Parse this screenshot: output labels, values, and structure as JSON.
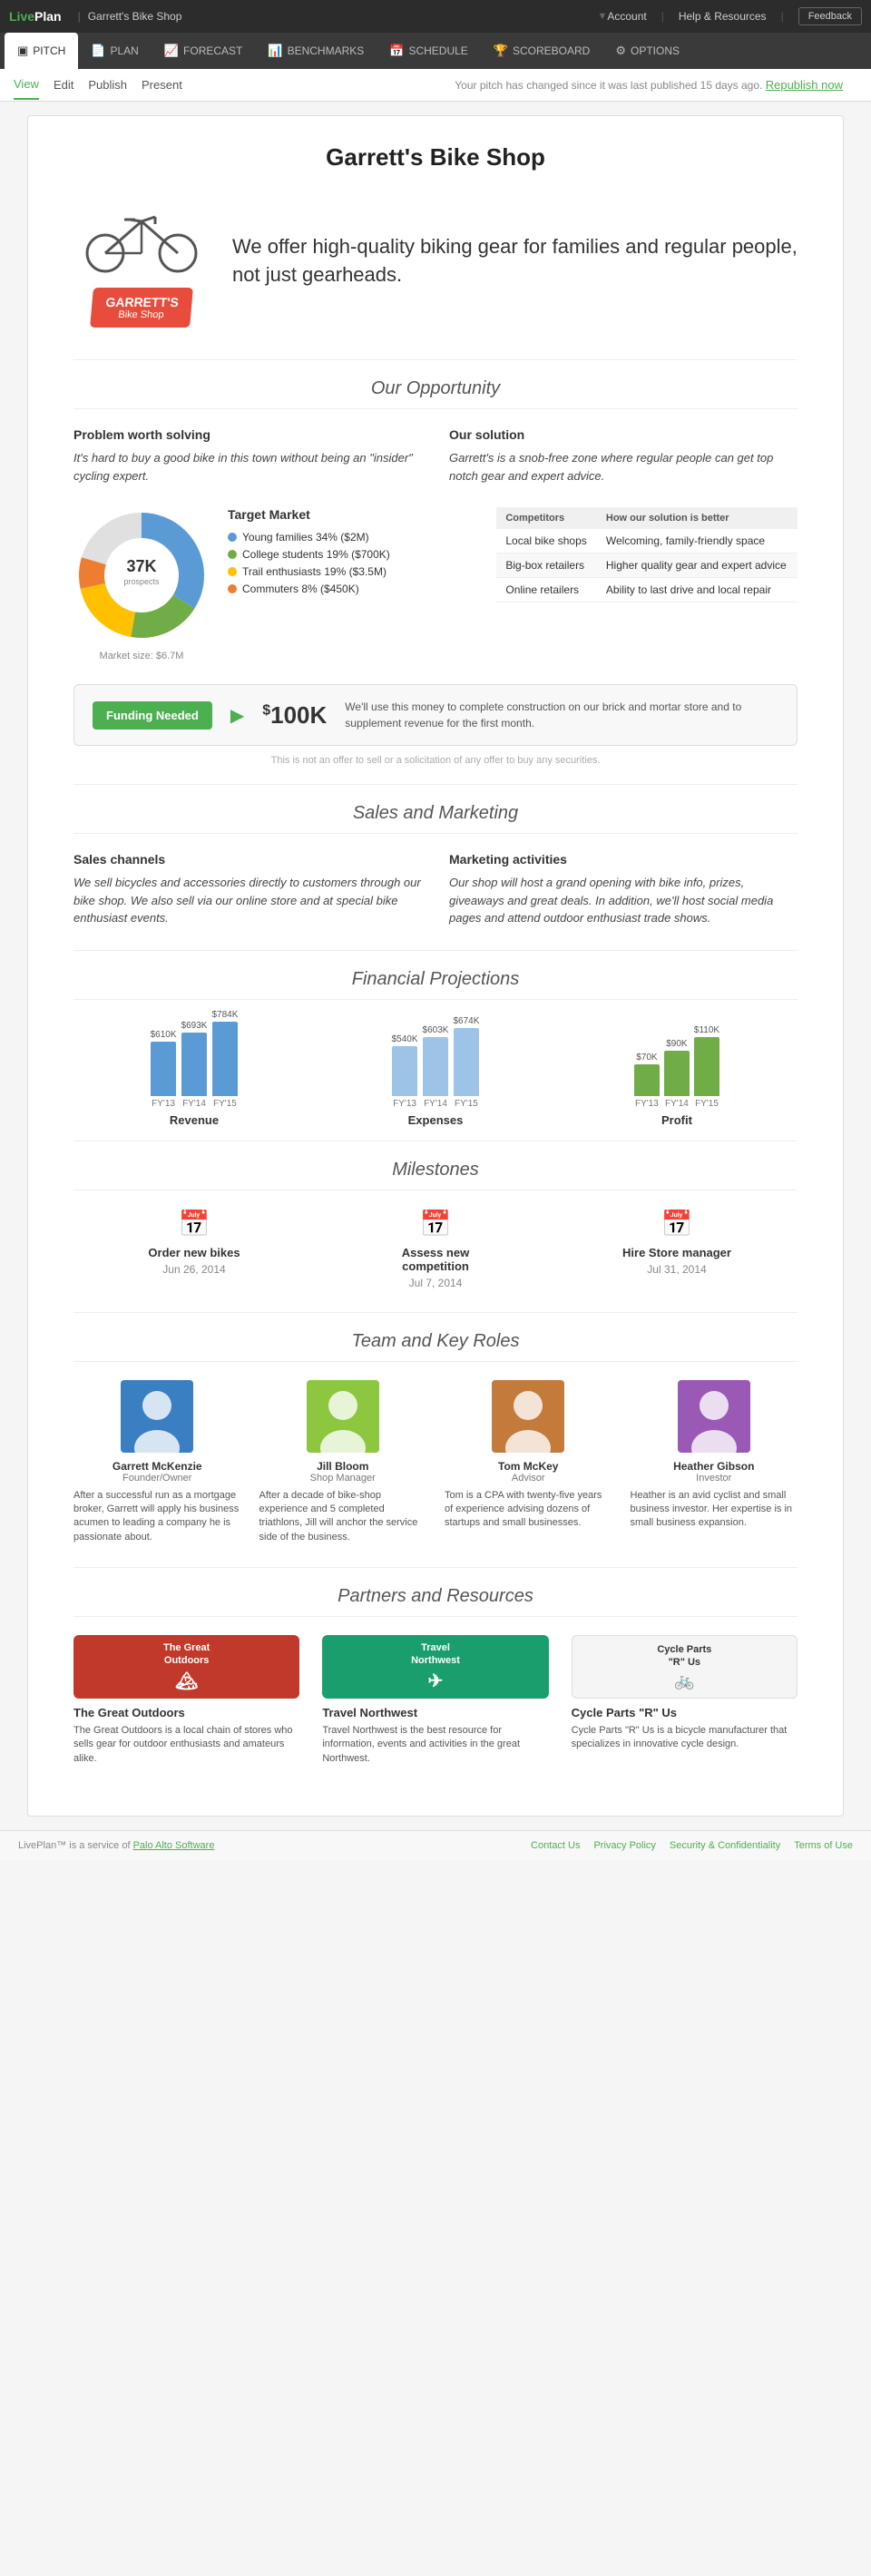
{
  "topnav": {
    "logo": "LivePlan",
    "shop_name": "Garrett's Bike Shop",
    "account_label": "Account",
    "help_label": "Help & Resources",
    "feedback_label": "Feedback"
  },
  "mainnav": {
    "tabs": [
      {
        "id": "pitch",
        "label": "PITCH",
        "icon": "📋",
        "active": true
      },
      {
        "id": "plan",
        "label": "PLAN",
        "icon": "📄"
      },
      {
        "id": "forecast",
        "label": "FORECAST",
        "icon": "📈"
      },
      {
        "id": "benchmarks",
        "label": "BENCHMARKS",
        "icon": "📊"
      },
      {
        "id": "schedule",
        "label": "SCHEDULE",
        "icon": "📅"
      },
      {
        "id": "scoreboard",
        "label": "SCOREBOARD",
        "icon": "🏆"
      },
      {
        "id": "options",
        "label": "OPTIONS",
        "icon": "⚙"
      }
    ]
  },
  "subnav": {
    "links": [
      "View",
      "Edit",
      "Publish",
      "Present"
    ],
    "active": "View",
    "notice": "Your pitch has changed since it was last published 15 days ago.",
    "republish_label": "Republish now"
  },
  "pitch": {
    "title": "Garrett's Bike Shop",
    "hero_tagline": "We offer high-quality biking gear for families and regular people, not just gearheads.",
    "logo_line1": "GARRETT'S",
    "logo_line2": "Bike Shop",
    "opportunity_title": "Our Opportunity",
    "problem_title": "Problem worth solving",
    "problem_text": "It's hard to buy a good bike in this town without being an \"insider\" cycling expert.",
    "solution_title": "Our solution",
    "solution_text": "Garrett's is a snob-free zone where regular people can get top notch gear and expert advice.",
    "target_market_title": "Target Market",
    "target_market_count": "37K",
    "target_market_sub": "prospects",
    "market_size": "Market size: $6.7M",
    "legend_items": [
      {
        "color": "#5b9bd5",
        "label": "Young families 34% ($2M)"
      },
      {
        "color": "#70ad47",
        "label": "College students 19% ($700K)"
      },
      {
        "color": "#ffc000",
        "label": "Trail enthusiasts 19% ($3.5M)"
      },
      {
        "color": "#ed7d31",
        "label": "Commuters 8% ($450K)"
      }
    ],
    "competitors_title": "Competitors",
    "competitors_col2": "How our solution is better",
    "competitors": [
      {
        "name": "Local bike shops",
        "advantage": "Welcoming, family-friendly space"
      },
      {
        "name": "Big-box retailers",
        "advantage": "Higher quality gear and expert advice"
      },
      {
        "name": "Online retailers",
        "advantage": "Ability to last drive and local repair"
      }
    ],
    "funding_title": "Funding Needed",
    "funding_amount": "$100K",
    "funding_desc": "We'll use this money to complete construction on our brick and mortar store and to supplement revenue for the first month.",
    "funding_disclaimer": "This is not an offer to sell or a solicitation of any offer to buy any securities.",
    "sales_marketing_title": "Sales and Marketing",
    "sales_channels_title": "Sales channels",
    "sales_channels_text": "We sell bicycles and accessories directly to customers through our bike shop. We also sell via our online store and at special bike enthusiast events.",
    "marketing_activities_title": "Marketing activities",
    "marketing_text": "Our shop will host a grand opening with bike info, prizes, giveaways and great deals. In addition, we'll host social media pages and attend outdoor enthusiast trade shows.",
    "financial_title": "Financial Projections",
    "revenue_bars": [
      {
        "label": "FY'13",
        "value": "$610K",
        "height": 60
      },
      {
        "label": "FY'14",
        "value": "$693K",
        "height": 70
      },
      {
        "label": "FY'15",
        "value": "$784K",
        "height": 82
      }
    ],
    "revenue_title": "Revenue",
    "expense_bars": [
      {
        "label": "FY'13",
        "value": "$540K",
        "height": 55
      },
      {
        "label": "FY'14",
        "value": "$603K",
        "height": 65
      },
      {
        "label": "FY'15",
        "value": "$674K",
        "height": 75
      }
    ],
    "expense_title": "Expenses",
    "profit_bars": [
      {
        "label": "FY'13",
        "value": "$70K",
        "height": 35
      },
      {
        "label": "FY'14",
        "value": "$90K",
        "height": 50
      },
      {
        "label": "FY'15",
        "value": "$110K",
        "height": 65
      }
    ],
    "profit_title": "Profit",
    "milestones_title": "Milestones",
    "milestones": [
      {
        "title": "Order new bikes",
        "date": "Jun 26, 2014"
      },
      {
        "title": "Assess new competition",
        "date": "Jul 7, 2014"
      },
      {
        "title": "Hire Store manager",
        "date": "Jul 31, 2014"
      }
    ],
    "team_title": "Team and Key Roles",
    "team": [
      {
        "name": "Garrett McKenzie",
        "role": "Founder/Owner",
        "bio": "After a successful run as a mortgage broker, Garrett will apply his business acumen to leading a company he is passionate about.",
        "color": "#3a7fc1"
      },
      {
        "name": "Jill Bloom",
        "role": "Shop Manager",
        "bio": "After a decade of bike-shop experience and 5 completed triathlons, Jill will anchor the service side of the business.",
        "color": "#8dc63f"
      },
      {
        "name": "Tom McKey",
        "role": "Advisor",
        "bio": "Tom is a CPA with twenty-five years of experience advising dozens of startups and small businesses.",
        "color": "#c47a3b"
      },
      {
        "name": "Heather Gibson",
        "role": "Investor",
        "bio": "Heather is an avid cyclist and small business investor. Her expertise is in small business expansion.",
        "color": "#9b59b6"
      }
    ],
    "partners_title": "Partners and Resources",
    "partners": [
      {
        "name": "The Great Outdoors",
        "desc": "The Great Outdoors is a local chain of stores who sells gear for outdoor enthusiasts and amateurs alike.",
        "bg": "#c0392b",
        "text_color": "#fff",
        "logo_text": "The Great Outdoors"
      },
      {
        "name": "Travel Northwest",
        "desc": "Travel Northwest is the best resource for information, events and activities in the great Northwest.",
        "bg": "#1a9e6e",
        "text_color": "#fff",
        "logo_text": "Travel Northwest"
      },
      {
        "name": "Cycle Parts \"R\" Us",
        "desc": "Cycle Parts \"R\" Us is a bicycle manufacturer that specializes in innovative cycle design.",
        "bg": "#f5f5f5",
        "text_color": "#333",
        "logo_text": "Cycle Parts \"R\" Us"
      }
    ]
  },
  "footer": {
    "left_text": "LivePlan™ is a service of",
    "company_link_text": "Palo Alto Software",
    "links": [
      {
        "label": "Contact Us",
        "href": "#"
      },
      {
        "label": "Privacy Policy",
        "href": "#"
      },
      {
        "label": "Security & Confidentiality",
        "href": "#"
      },
      {
        "label": "Terms of Use",
        "href": "#"
      }
    ]
  }
}
